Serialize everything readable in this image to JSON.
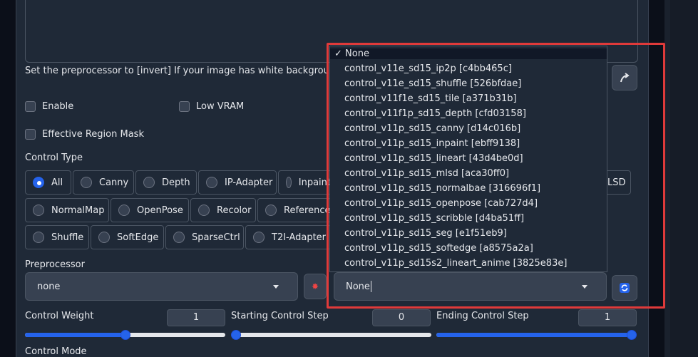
{
  "hint_text": "Set the preprocessor to [invert] If your image has white background and bla",
  "checkboxes": {
    "enable": "Enable",
    "low_vram": "Low VRAM",
    "effective_region_mask": "Effective Region Mask"
  },
  "control_type": {
    "label": "Control Type",
    "row1": [
      "All",
      "Canny",
      "Depth",
      "IP-Adapter",
      "Inpaint"
    ],
    "row1_tail": "LSD",
    "row2": [
      "NormalMap",
      "OpenPose",
      "Recolor",
      "Reference"
    ],
    "row3": [
      "Shuffle",
      "SoftEdge",
      "SparseCtrl",
      "T2I-Adapter"
    ],
    "selected": "All"
  },
  "preprocessor": {
    "label": "Preprocessor",
    "value": "none"
  },
  "model": {
    "value": "None"
  },
  "model_options": [
    "None",
    "control_v11e_sd15_ip2p [c4bb465c]",
    "control_v11e_sd15_shuffle [526bfdae]",
    "control_v11f1e_sd15_tile [a371b31b]",
    "control_v11f1p_sd15_depth [cfd03158]",
    "control_v11p_sd15_canny [d14c016b]",
    "control_v11p_sd15_inpaint [ebff9138]",
    "control_v11p_sd15_lineart [43d4be0d]",
    "control_v11p_sd15_mlsd [aca30ff0]",
    "control_v11p_sd15_normalbae [316696f1]",
    "control_v11p_sd15_openpose [cab727d4]",
    "control_v11p_sd15_scribble [d4ba51ff]",
    "control_v11p_sd15_seg [e1f51eb9]",
    "control_v11p_sd15_softedge [a8575a2a]",
    "control_v11p_sd15s2_lineart_anime [3825e83e]"
  ],
  "selected_mark": "✓",
  "control_weight": {
    "label": "Control Weight",
    "value": "1",
    "fraction": 0.5
  },
  "starting_step": {
    "label": "Starting Control Step",
    "value": "0",
    "fraction": 0
  },
  "ending_step": {
    "label": "Ending Control Step",
    "value": "1",
    "fraction": 1
  },
  "control_mode": {
    "label": "Control Mode"
  },
  "icons": {
    "upload": "curved-arrow-icon",
    "run": "spark-icon",
    "refresh": "refresh-icon"
  },
  "colors": {
    "accent": "#2563eb",
    "highlight": "#e03a3a"
  }
}
